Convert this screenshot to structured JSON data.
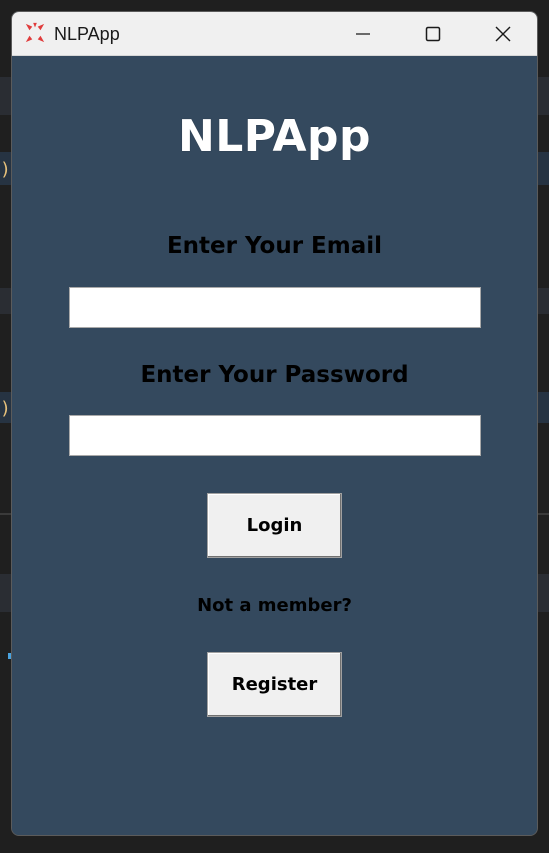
{
  "window": {
    "title": "NLPApp",
    "icon": "angry-burst-icon",
    "controls": {
      "minimize": "minimize-icon",
      "maximize": "maximize-icon",
      "close": "close-icon"
    }
  },
  "app": {
    "heading": "NLPApp",
    "email_label": "Enter Your Email",
    "email_value": "",
    "password_label": "Enter Your Password",
    "password_value": "",
    "login_button": "Login",
    "member_prompt": "Not a member?",
    "register_button": "Register"
  },
  "background": {
    "visible_glyphs": [
      ")",
      ")"
    ]
  },
  "colors": {
    "window_background": "#34495e",
    "titlebar_background": "#f0f0f0",
    "button_background": "#f0f0f0",
    "heading_text": "#ffffff",
    "label_text": "#000000",
    "icon_accent": "#e03b3b"
  }
}
